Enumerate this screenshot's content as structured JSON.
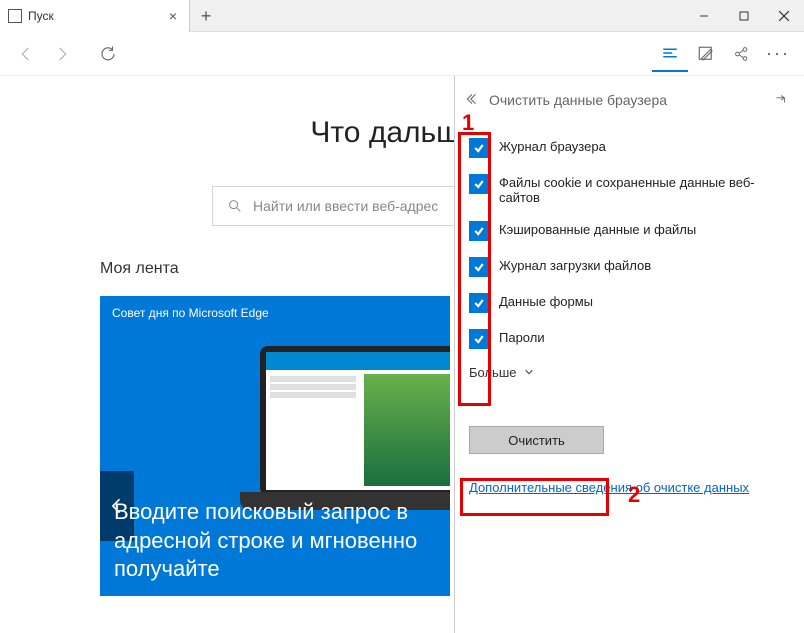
{
  "tab": {
    "title": "Пуск"
  },
  "window": {
    "minimize": "—",
    "maximize": "☐",
    "close": "✕"
  },
  "main": {
    "heading": "Что дальше?",
    "search_placeholder": "Найти или ввести веб-адрес",
    "feed_title": "Моя лента",
    "card_header": "Совет дня по Microsoft Edge",
    "card_text": "Вводите поисковый запрос в адресной строке и мгновенно получайте"
  },
  "panel": {
    "title": "Очистить данные браузера",
    "items": [
      {
        "label": "Журнал браузера",
        "checked": true
      },
      {
        "label": "Файлы cookie и сохраненные данные веб-сайтов",
        "checked": true
      },
      {
        "label": "Кэшированные данные и файлы",
        "checked": true
      },
      {
        "label": "Журнал загрузки файлов",
        "checked": true
      },
      {
        "label": "Данные формы",
        "checked": true
      },
      {
        "label": "Пароли",
        "checked": true
      }
    ],
    "more": "Больше",
    "clear_button": "Очистить",
    "learn_more": "Дополнительные сведения об очистке данных"
  },
  "annotations": {
    "label1": "1",
    "label2": "2"
  }
}
